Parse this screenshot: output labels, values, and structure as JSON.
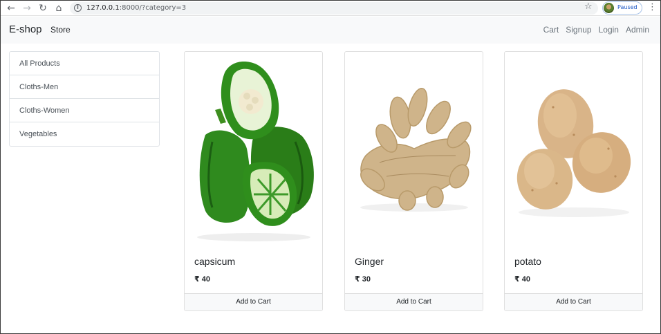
{
  "browser": {
    "url_host": "127.0.0.1",
    "url_rest": ":8000/?category=3",
    "profile_status": "Paused",
    "back_icon": "arrow-left-icon",
    "forward_icon": "arrow-right-icon",
    "reload_icon": "reload-icon",
    "home_icon": "home-icon",
    "star_icon": "star-icon",
    "menu_icon": "kebab-menu-icon"
  },
  "navbar": {
    "brand": "E-shop",
    "store": "Store",
    "links": [
      "Cart",
      "Signup",
      "Login",
      "Admin"
    ],
    "background": "#f8f9fa"
  },
  "sidebar": {
    "items": [
      "All Products",
      "Cloths-Men",
      "Cloths-Women",
      "Vegetables"
    ]
  },
  "products": [
    {
      "name": "capsicum",
      "price": "₹ 40",
      "button": "Add to Cart",
      "image": "green-capsicum-image"
    },
    {
      "name": "Ginger",
      "price": "₹ 30",
      "button": "Add to Cart",
      "image": "ginger-root-image"
    },
    {
      "name": "potato",
      "price": "₹ 40",
      "button": "Add to Cart",
      "image": "potatoes-image"
    }
  ]
}
